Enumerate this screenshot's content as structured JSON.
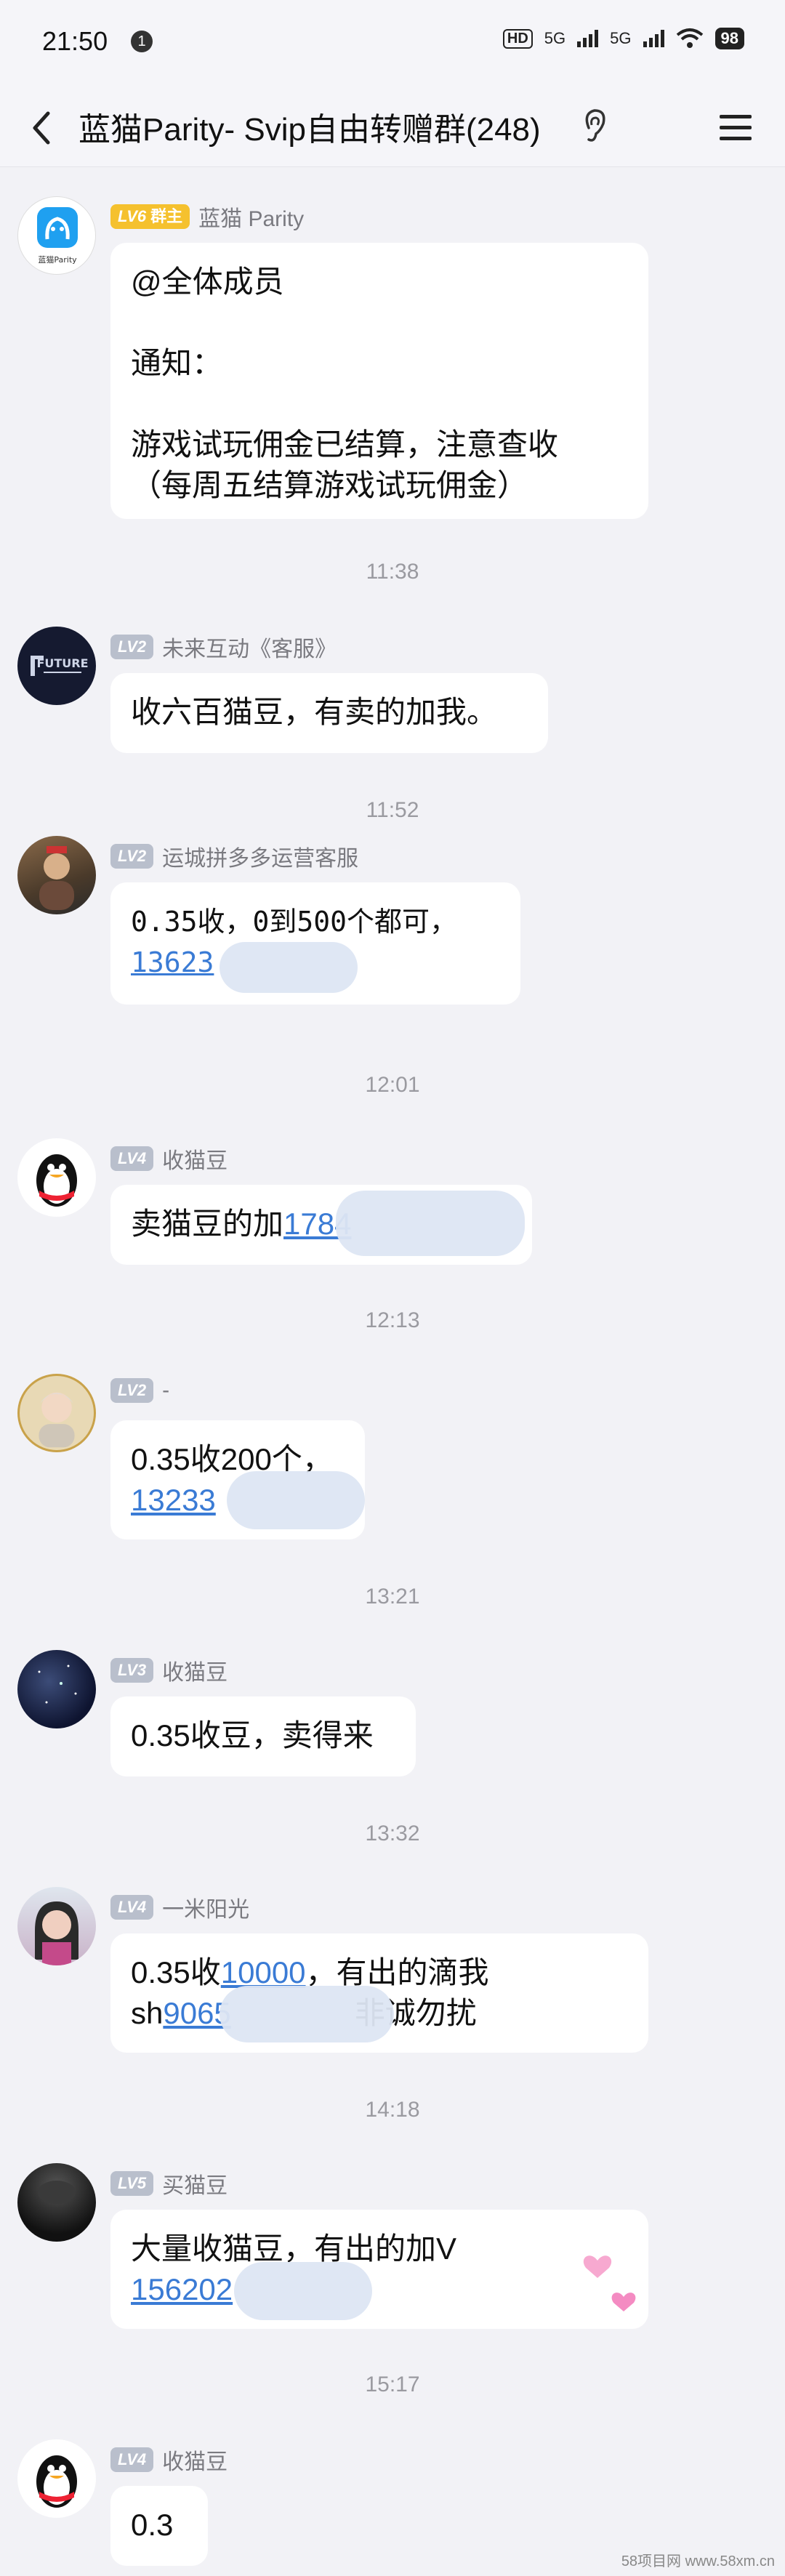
{
  "status_bar": {
    "time": "21:50",
    "notif_count": "1",
    "hd": "HD",
    "net1": "5G",
    "net2": "5G",
    "battery": "98"
  },
  "header": {
    "title": "蓝猫Parity- Svip自由转赠群(248)"
  },
  "messages": [
    {
      "level": "LV6",
      "role": "群主",
      "sender": "蓝猫 Parity",
      "lines": [
        "@全体成员",
        "",
        "通知：",
        "",
        "游戏试玩佣金已结算，注意查收",
        "（每周五结算游戏试玩佣金）"
      ]
    },
    {
      "level": "LV2",
      "sender": "未来互动《客服》",
      "text": "收六百猫豆，有卖的加我。"
    },
    {
      "level": "LV2",
      "sender": "运城拼多多运营客服",
      "line1": "0.35收，0到500个都可，",
      "link": "13623"
    },
    {
      "level": "LV4",
      "sender": "收猫豆",
      "text": "卖猫豆的加",
      "link": "1784"
    },
    {
      "level": "LV2",
      "sender": "-",
      "line1": "0.35收200个，",
      "link": "13233"
    },
    {
      "level": "LV3",
      "sender": "收猫豆",
      "text": "0.35收豆，卖得来"
    },
    {
      "level": "LV4",
      "sender": "一米阳光",
      "pre": "0.35收",
      "link1": "10000",
      "post": "，有出的滴我",
      "line2_pre": "sh",
      "link2": "9065",
      "line2_post": "非诚勿扰"
    },
    {
      "level": "LV5",
      "sender": "买猫豆",
      "line1": "大量收猫豆，有出的加V",
      "link": "156202"
    },
    {
      "level": "LV4",
      "sender": "收猫豆",
      "text": "0.3"
    }
  ],
  "times": [
    "11:38",
    "11:52",
    "12:01",
    "12:13",
    "13:21",
    "13:32",
    "14:18",
    "15:17"
  ],
  "avatar_captions": {
    "lanmao": "蓝猫Parity",
    "future": "FUTURE"
  },
  "watermark": {
    "brand": "58项目网",
    "url": "www.58xm.cn"
  }
}
